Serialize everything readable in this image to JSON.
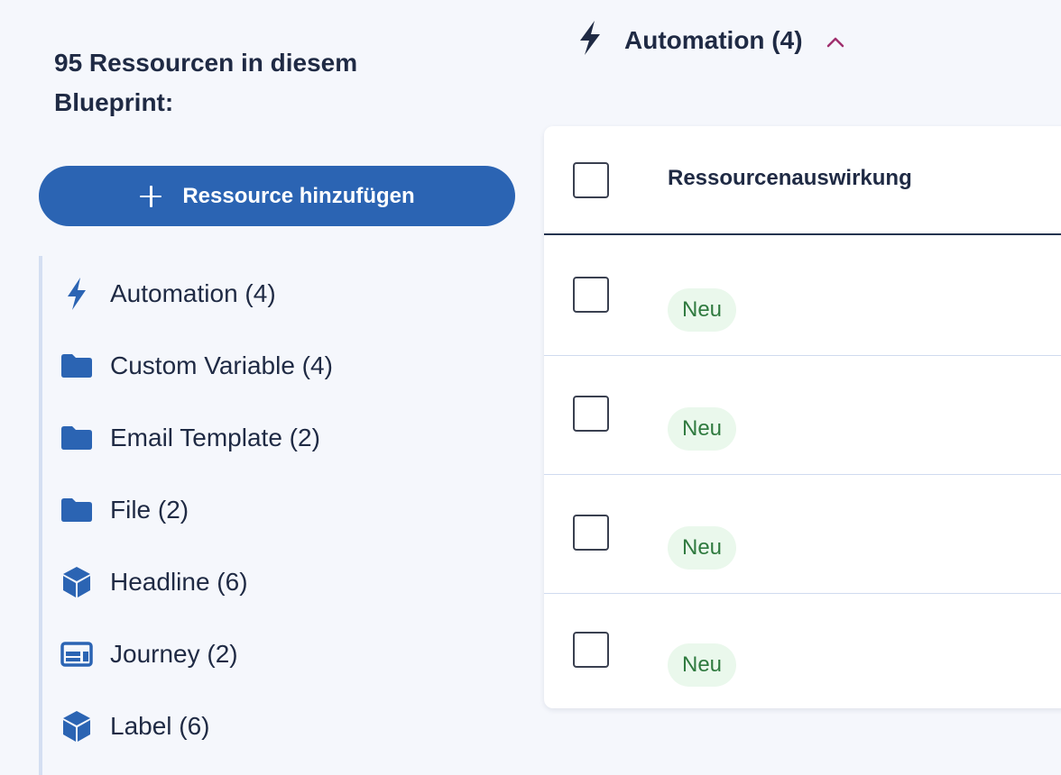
{
  "sidebar": {
    "resource_count_heading": "95 Ressourcen in diesem Blueprint:",
    "add_button_label": "Ressource hinzufügen",
    "items": [
      {
        "label": "Automation (4)",
        "icon": "bolt-icon"
      },
      {
        "label": "Custom Variable (4)",
        "icon": "folder-icon"
      },
      {
        "label": "Email Template (2)",
        "icon": "folder-icon"
      },
      {
        "label": "File (2)",
        "icon": "folder-icon"
      },
      {
        "label": "Headline (6)",
        "icon": "cube-icon"
      },
      {
        "label": "Journey (2)",
        "icon": "card-icon"
      },
      {
        "label": "Label (6)",
        "icon": "cube-icon"
      }
    ]
  },
  "section": {
    "title": "Automation (4)",
    "icon": "bolt-icon",
    "toggle_icon": "chevron-up-icon"
  },
  "table": {
    "column_header": "Ressourcenauswirkung",
    "rows": [
      {
        "badge": "Neu"
      },
      {
        "badge": "Neu"
      },
      {
        "badge": "Neu"
      },
      {
        "badge": "Neu"
      }
    ]
  },
  "colors": {
    "primary": "#2b64b3",
    "text": "#1f2a44",
    "background": "#f5f7fc",
    "badge_bg": "#eaf8ec",
    "badge_text": "#2f7a3f",
    "chevron": "#a0306e"
  }
}
